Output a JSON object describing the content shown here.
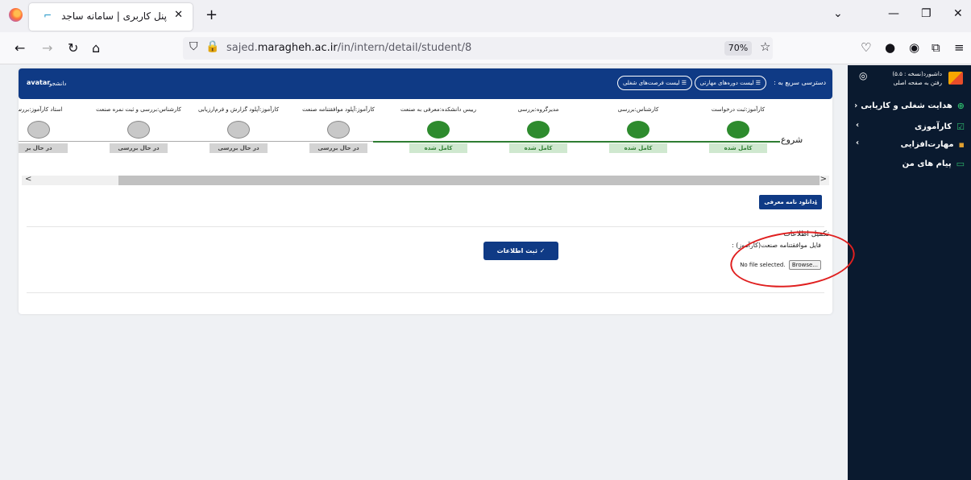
{
  "browser": {
    "tab_title": "پنل کاربری | سامانه ساجد",
    "url_prefix": "sajed.",
    "url_domain": "maragheh.ac.ir",
    "url_path": "/in/intern/detail/student/8",
    "zoom": "70%"
  },
  "sidebar": {
    "title_line1": "داشبورد(نسخه : ۵.۵)",
    "title_line2": "رفتن به صفحه اصلی",
    "items": [
      {
        "label": "هدایت شغلی و کاریابی",
        "icon": "plus-circle-icon"
      },
      {
        "label": "کارآموزی",
        "icon": "check-square-icon"
      },
      {
        "label": "مهارت‌افزایی",
        "icon": "chart-icon"
      },
      {
        "label": "پیام های من",
        "icon": "message-icon"
      }
    ]
  },
  "header": {
    "quick_access": "دسترسی سریع به :",
    "pill_skills": "☰ لیست دوره‌های مهارتی",
    "pill_jobs": "☰ لیست فرصت‌های شغلی",
    "avatar": "avatar",
    "role": "دانشجو"
  },
  "timeline": {
    "start_label": "شروع",
    "steps": [
      {
        "label": "کارآموز:ثبت درخواست",
        "status": "کامل شده",
        "done": true
      },
      {
        "label": "کارشناس:بررسی",
        "status": "کامل شده",
        "done": true
      },
      {
        "label": "مدیرگروه:بررسی",
        "status": "کامل شده",
        "done": true
      },
      {
        "label": "رییس دانشکده:معرفی به صنعت",
        "status": "کامل شده",
        "done": true
      },
      {
        "label": "کارآموز:آپلود موافقتنامه صنعت",
        "status": "در حال بررسی",
        "done": false
      },
      {
        "label": "کارآموز:آپلود گزارش و فرم‌ارزیابی",
        "status": "در حال بررسی",
        "done": false
      },
      {
        "label": "کارشناس:بررسی و ثبت نمره صنعت",
        "status": "در حال بررسی",
        "done": false
      },
      {
        "label": "استاد کارآموز:بررس",
        "status": "در حال بر",
        "done": false
      }
    ]
  },
  "content": {
    "download_button": "⤓دانلود نامه معرفی",
    "complete_info": "تکمیل اطلاعات",
    "file_label": "فایل موافقتنامه صنعت(کارآموز) :",
    "browse": "Browse...",
    "no_file": "No file selected.",
    "submit_button": "✓ ثبت اطلاعات"
  },
  "colors": {
    "primary": "#0f3a85",
    "sidebar_bg": "#0a1a2f",
    "done_green": "#2e8b2e",
    "annotation_red": "#e02020"
  }
}
